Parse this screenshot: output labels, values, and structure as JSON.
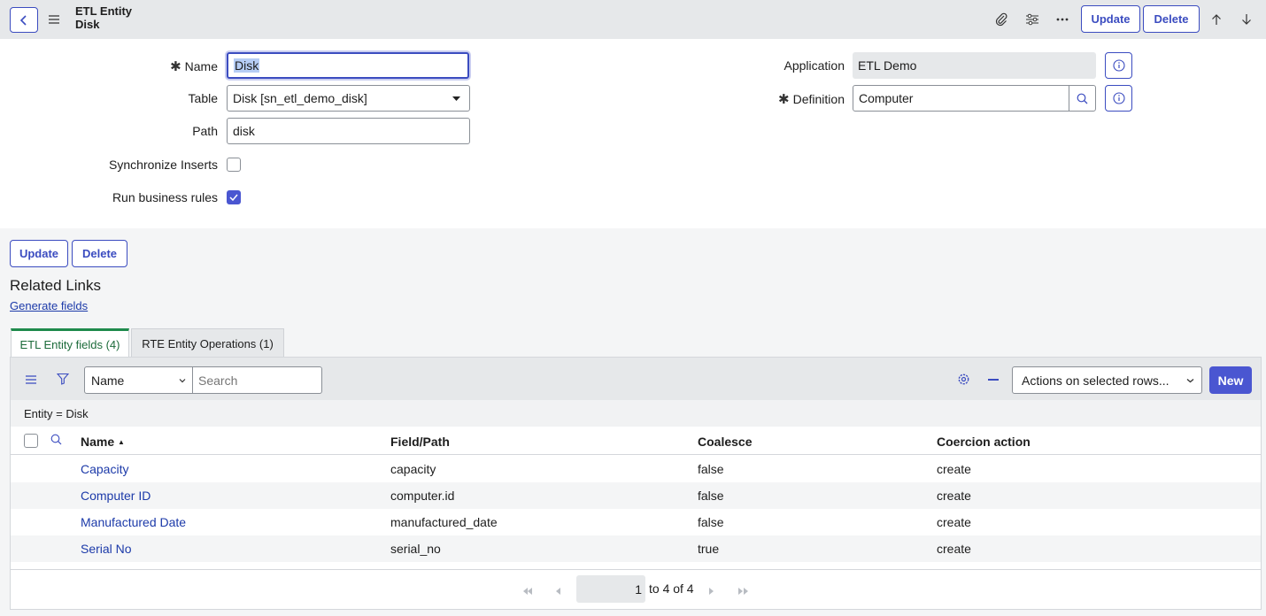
{
  "header": {
    "title_line1": "ETL Entity",
    "title_line2": "Disk",
    "update_label": "Update",
    "delete_label": "Delete"
  },
  "form": {
    "name_label": "Name",
    "name_value": "Disk",
    "table_label": "Table",
    "table_value": "Disk [sn_etl_demo_disk]",
    "path_label": "Path",
    "path_value": "disk",
    "sync_label": "Synchronize Inserts",
    "sync_checked": false,
    "run_rules_label": "Run business rules",
    "run_rules_checked": true,
    "application_label": "Application",
    "application_value": "ETL Demo",
    "definition_label": "Definition",
    "definition_value": "Computer"
  },
  "bottom_buttons": {
    "update_label": "Update",
    "delete_label": "Delete"
  },
  "related": {
    "title": "Related Links",
    "generate_link": "Generate fields"
  },
  "tabs": [
    {
      "label": "ETL Entity fields (4)",
      "active": true
    },
    {
      "label": "RTE Entity Operations (1)",
      "active": false
    }
  ],
  "list": {
    "search_field": "Name",
    "search_placeholder": "Search",
    "actions_select": "Actions on selected rows...",
    "new_label": "New",
    "filter_text": "Entity = Disk",
    "columns": [
      "Name",
      "Field/Path",
      "Coalesce",
      "Coercion action"
    ],
    "sort_indicator": "▲",
    "rows": [
      {
        "name": "Capacity",
        "path": "capacity",
        "coalesce": "false",
        "coercion": "create"
      },
      {
        "name": "Computer ID",
        "path": "computer.id",
        "coalesce": "false",
        "coercion": "create"
      },
      {
        "name": "Manufactured Date",
        "path": "manufactured_date",
        "coalesce": "false",
        "coercion": "create"
      },
      {
        "name": "Serial No",
        "path": "serial_no",
        "coalesce": "true",
        "coercion": "create"
      }
    ],
    "pagination": {
      "current": "1",
      "range_text": "to 4 of 4"
    }
  },
  "colors": {
    "accent": "#3b4cc0",
    "header_bg": "#e6e8ea",
    "tab_active": "#1f8a4c",
    "link": "#1c3aa9"
  }
}
